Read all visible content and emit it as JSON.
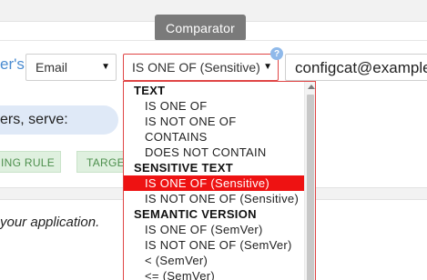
{
  "header": {
    "tab_label": "Comparator"
  },
  "rule": {
    "attribute_prefix": "er's",
    "attribute_select": "Email",
    "comparator_select": "IS ONE OF (Sensitive)",
    "info_badge": "?",
    "comparison_value": "configcat@example"
  },
  "serve": {
    "label": "ers, serve:"
  },
  "tags": [
    {
      "label": "ING RULE"
    },
    {
      "label": "TARGE"
    }
  ],
  "footer": {
    "text": "your application."
  },
  "comparator_dropdown": {
    "groups": [
      {
        "label": "TEXT",
        "items": [
          "IS ONE OF",
          "IS NOT ONE OF",
          "CONTAINS",
          "DOES NOT CONTAIN"
        ]
      },
      {
        "label": "SENSITIVE TEXT",
        "items": [
          "IS ONE OF (Sensitive)",
          "IS NOT ONE OF (Sensitive)"
        ]
      },
      {
        "label": "SEMANTIC VERSION",
        "items": [
          "IS ONE OF (SemVer)",
          "IS NOT ONE OF (SemVer)",
          "< (SemVer)",
          "<= (SemVer)"
        ]
      }
    ],
    "selected": "IS ONE OF (Sensitive)"
  },
  "colors": {
    "accent_blue": "#4a8bd0",
    "error_red": "#e04545",
    "selected_red": "#ee1212",
    "tag_green": "#4d8f4d"
  }
}
